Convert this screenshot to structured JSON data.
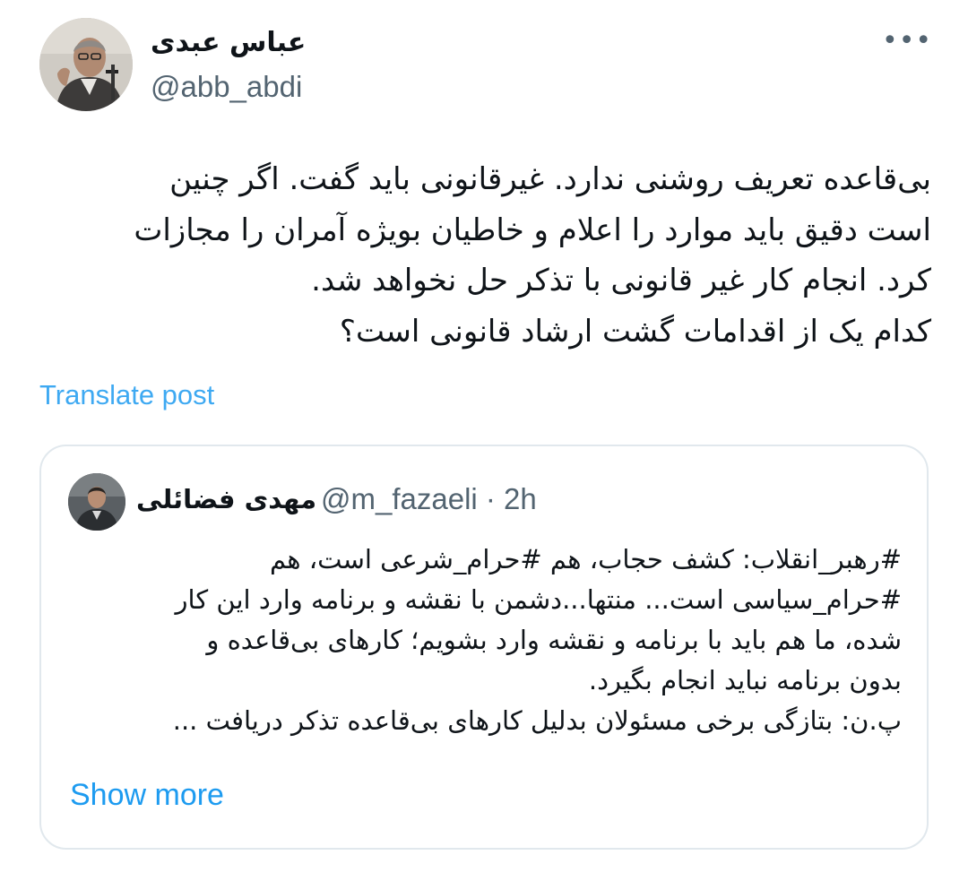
{
  "tweet": {
    "author_name": "عباس عبدی",
    "author_handle": "@abb_abdi",
    "more_icon": "more-horizontal-icon",
    "text": "بی‌قاعده تعریف روشنی ندارد. غیرقانونی باید گفت. اگر چنین\nاست دقیق باید موارد را اعلام و خاطیان بویژه آمران را مجازات\nکرد. انجام کار غیر قانونی با تذکر حل نخواهد شد.\nکدام یک از اقدامات گشت ارشاد قانونی است؟",
    "translate_label": "Translate post"
  },
  "quote": {
    "author_name": "مهدی فضائلی",
    "meta": "@m_fazaeli · 2h",
    "text": "#رهبر_انقلاب: کشف حجاب، هم #حرام_شرعی است، هم\n#حرام_سیاسی است... منتها...دشمن با نقشه و برنامه وارد این کار\nشده، ما هم باید با برنامه و نقشه وارد بشویم؛ کارهای بی‌قاعده و\nبدون برنامه نباید انجام بگیرد.\nپ.ن: بتازگی برخی مسئولان بدلیل کارهای بی‌قاعده تذکر دریافت ...",
    "show_more_label": "Show more"
  },
  "colors": {
    "link": "#1d9bf0",
    "secondary_text": "#536471",
    "border": "#e1e8ed"
  }
}
